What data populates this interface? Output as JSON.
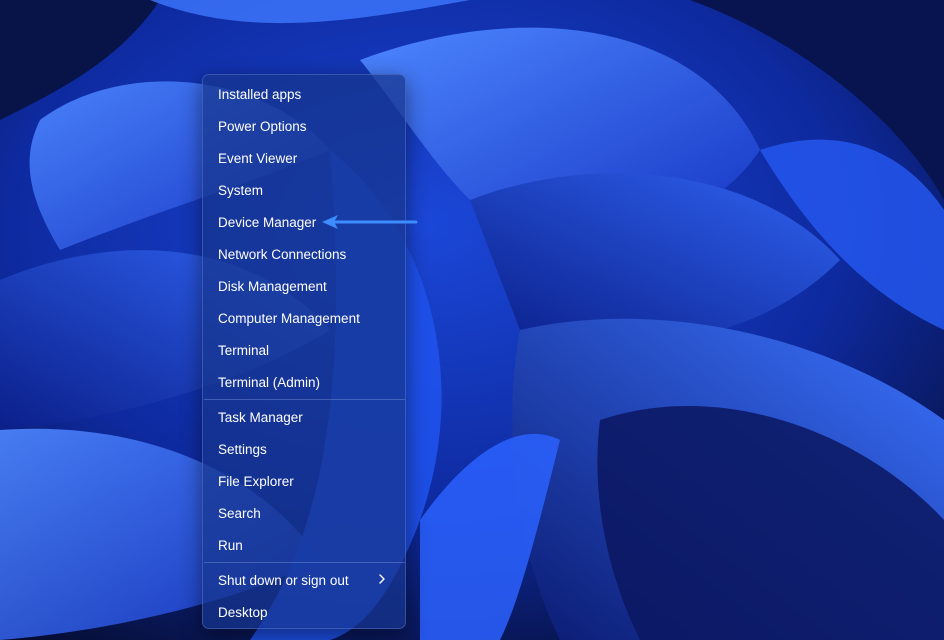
{
  "menu": {
    "items": [
      {
        "label": "Installed apps"
      },
      {
        "label": "Power Options"
      },
      {
        "label": "Event Viewer"
      },
      {
        "label": "System"
      },
      {
        "label": "Device Manager"
      },
      {
        "label": "Network Connections"
      },
      {
        "label": "Disk Management"
      },
      {
        "label": "Computer Management"
      },
      {
        "label": "Terminal"
      },
      {
        "label": "Terminal (Admin)"
      },
      {
        "label": "Task Manager"
      },
      {
        "label": "Settings"
      },
      {
        "label": "File Explorer"
      },
      {
        "label": "Search"
      },
      {
        "label": "Run"
      },
      {
        "label": "Shut down or sign out",
        "submenu": true
      },
      {
        "label": "Desktop"
      }
    ]
  },
  "annotation": {
    "target": "Device Manager",
    "color": "#3d8dff"
  },
  "colors": {
    "wallpaper_dark": "#060d2e",
    "wallpaper_blue": "#1d4fe6",
    "wallpaper_light": "#5a8cff"
  }
}
